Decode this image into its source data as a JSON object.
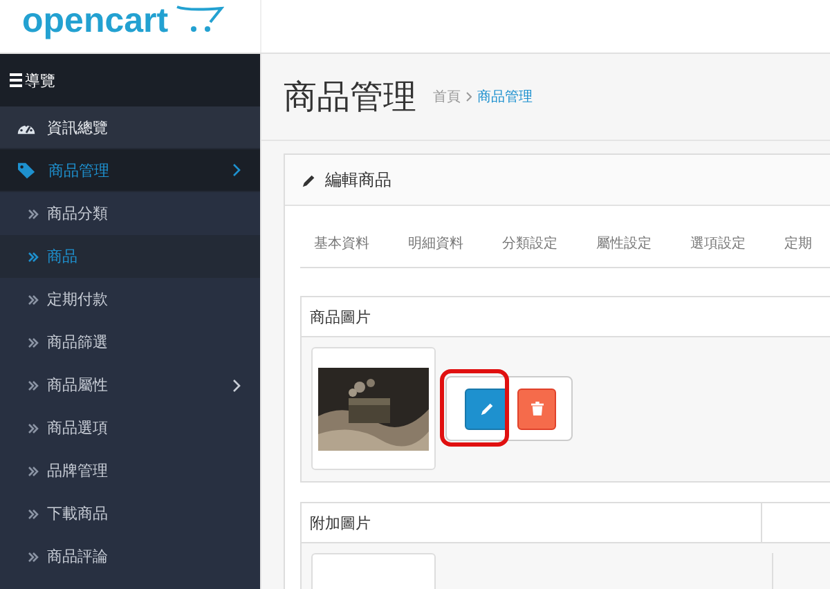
{
  "logo": {
    "text": "opencart"
  },
  "sidebar": {
    "heading": "導覽",
    "items": [
      {
        "label": "資訊總覽",
        "kind": "dashboard",
        "selected": false,
        "expandable": false
      },
      {
        "label": "商品管理",
        "kind": "tag",
        "selected": true,
        "expandable": true
      },
      {
        "label": "商品分類",
        "kind": "sub",
        "selected": false,
        "expandable": false
      },
      {
        "label": "商品",
        "kind": "sub",
        "selected": true,
        "expandable": false
      },
      {
        "label": "定期付款",
        "kind": "sub",
        "selected": false,
        "expandable": false
      },
      {
        "label": "商品篩選",
        "kind": "sub",
        "selected": false,
        "expandable": false
      },
      {
        "label": "商品屬性",
        "kind": "sub",
        "selected": false,
        "expandable": true
      },
      {
        "label": "商品選項",
        "kind": "sub",
        "selected": false,
        "expandable": false
      },
      {
        "label": "品牌管理",
        "kind": "sub",
        "selected": false,
        "expandable": false
      },
      {
        "label": "下載商品",
        "kind": "sub",
        "selected": false,
        "expandable": false
      },
      {
        "label": "商品評論",
        "kind": "sub",
        "selected": false,
        "expandable": false
      }
    ]
  },
  "page": {
    "title": "商品管理",
    "breadcrumb": [
      {
        "label": "首頁"
      },
      {
        "label": "商品管理"
      }
    ]
  },
  "panel": {
    "title": "編輯商品",
    "tabs": [
      {
        "label": "基本資料",
        "selected": false
      },
      {
        "label": "明細資料",
        "selected": false
      },
      {
        "label": "分類設定",
        "selected": false
      },
      {
        "label": "屬性設定",
        "selected": false
      },
      {
        "label": "選項設定",
        "selected": false
      },
      {
        "label": "定期",
        "selected": false
      }
    ],
    "image_table": {
      "heading": "商品圖片"
    },
    "additional_table": {
      "heading": "附加圖片"
    }
  },
  "popover": {
    "buttons": [
      {
        "kind": "edit",
        "highlighted": true
      },
      {
        "kind": "delete",
        "highlighted": false
      }
    ]
  }
}
